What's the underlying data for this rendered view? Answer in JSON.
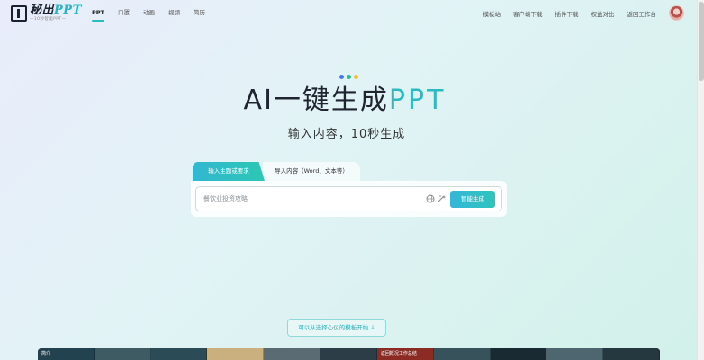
{
  "brand": {
    "logo_main": "秘出",
    "logo_ppt": "PPT",
    "logo_sub": "—10秒智能PPT—"
  },
  "nav": {
    "left": [
      "PPT",
      "口罩",
      "动画",
      "视频",
      "简历"
    ],
    "right": [
      "模板站",
      "客户端下载",
      "插件下载",
      "权益对比",
      "返回工作台"
    ]
  },
  "hero": {
    "title_main": "AI一键生成",
    "title_accent": "PPT",
    "subtitle": "输入内容，10秒生成",
    "dot_colors": [
      "#4b77e9",
      "#2fbf8a",
      "#f5c12c"
    ]
  },
  "tabs": {
    "active": "输入主题或要求",
    "inactive": "导入内容（Word、文本等）"
  },
  "input": {
    "placeholder": "餐饮业投资攻略",
    "value": ""
  },
  "buttons": {
    "generate": "智能生成",
    "template_pick": "可以从选择心仪的模板开始 ↓"
  },
  "templates": {
    "labels": [
      "简介",
      "",
      "",
      "",
      "",
      "",
      "返回概况工作总结",
      "",
      "",
      "",
      ""
    ],
    "colors": [
      "#23424f",
      "#3e5a63",
      "#2b4b56",
      "#c9b07e",
      "#5b6b74",
      "#2c3d47",
      "#8c2b24",
      "#37525b",
      "#1a2a33",
      "#4e6670",
      "#26383f"
    ]
  },
  "colors": {
    "accent": "#2bbac4",
    "nav_active_underline": "#2bbcc5"
  }
}
